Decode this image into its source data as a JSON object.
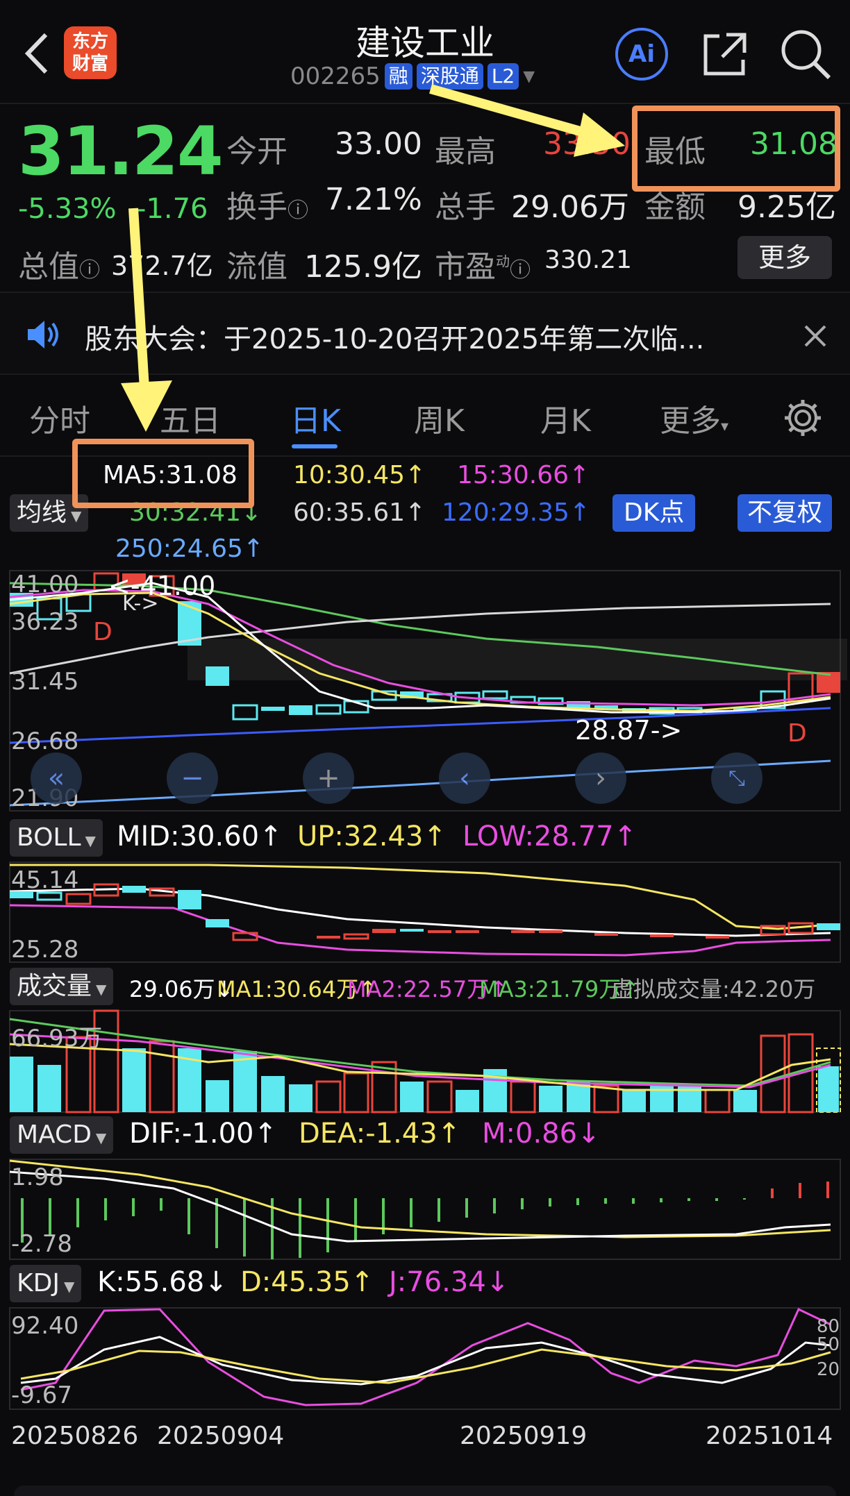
{
  "header": {
    "title": "建设工业",
    "code": "002265",
    "tags": [
      "融",
      "深股通",
      "L2"
    ],
    "logo_line1": "东方",
    "logo_line2": "财富",
    "ai_label": "Ai"
  },
  "quote": {
    "price": "31.24",
    "change_pct": "-5.33%",
    "change": "-1.76",
    "fields": {
      "open_label": "今开",
      "open": "33.00",
      "high_label": "最高",
      "high": "33.50",
      "low_label": "最低",
      "low": "31.08",
      "turnover_label": "换手",
      "turnover": "7.21%",
      "volume_label": "总手",
      "volume": "29.06万",
      "amount_label": "金额",
      "amount": "9.25亿",
      "mcap_label": "总值",
      "mcap": "372.7亿",
      "float_label": "流值",
      "float": "125.9亿",
      "pe_label": "市盈",
      "pe_sup": "动",
      "pe": "330.21",
      "more": "更多"
    }
  },
  "notice": {
    "text": "股东大会：于2025-10-20召开2025年第二次临..."
  },
  "tabs": [
    "分时",
    "五日",
    "日K",
    "周K",
    "月K",
    "更多"
  ],
  "active_tab": "日K",
  "ma": {
    "selector": "均线",
    "ma5": "MA5:31.08",
    "ma10": "10:30.45↑",
    "ma15": "15:30.66↑",
    "ma30": "30:32.41↓",
    "ma60": "60:35.61↑",
    "ma120": "120:29.35↑",
    "ma250": "250:24.65↑",
    "dk": "DK点",
    "fq": "不复权"
  },
  "kline": {
    "y_labels": [
      "41.00",
      "36.23",
      "31.45",
      "26.68",
      "21.90"
    ],
    "high_note": "<-41.00",
    "low_note": "28.87->",
    "k_note": "K->",
    "d_marker": "D"
  },
  "boll": {
    "selector": "BOLL",
    "mid": "MID:30.60↑",
    "up": "UP:32.43↑",
    "low": "LOW:28.77↑",
    "y_labels": [
      "45.14",
      "25.28"
    ]
  },
  "volume": {
    "selector": "成交量",
    "vol": "29.06万↓",
    "ma1": "MA1:30.64万↑",
    "ma2": "MA2:22.57万↑",
    "ma3": "MA3:21.79万↑",
    "virtual": "虚拟成交量:42.20万",
    "y_label": "66.93万"
  },
  "macd": {
    "selector": "MACD",
    "dif": "DIF:-1.00↑",
    "dea": "DEA:-1.43↑",
    "m": "M:0.86↓",
    "y_labels": [
      "1.98",
      "-2.78"
    ]
  },
  "kdj": {
    "selector": "KDJ",
    "k": "K:55.68↓",
    "d": "D:45.35↑",
    "j": "J:76.34↓",
    "y_labels": [
      "92.40",
      "-9.67"
    ],
    "right_labels": [
      "80",
      "50",
      "20"
    ]
  },
  "dates": [
    "20250826",
    "20250904",
    "20250919",
    "20251014"
  ],
  "colors": {
    "accent": "#4a8fff",
    "up": "#e8453c",
    "down": "#5ee8f0",
    "ma5": "#ffffff",
    "ma10": "#f5e663",
    "ma15": "#e84ee0",
    "ma30": "#5cc95c",
    "ma60": "#d8d8d8",
    "ma120": "#3c5cff",
    "ma250": "#6aaaff",
    "highlight": "#f0935a",
    "arrow": "#fff37a"
  }
}
